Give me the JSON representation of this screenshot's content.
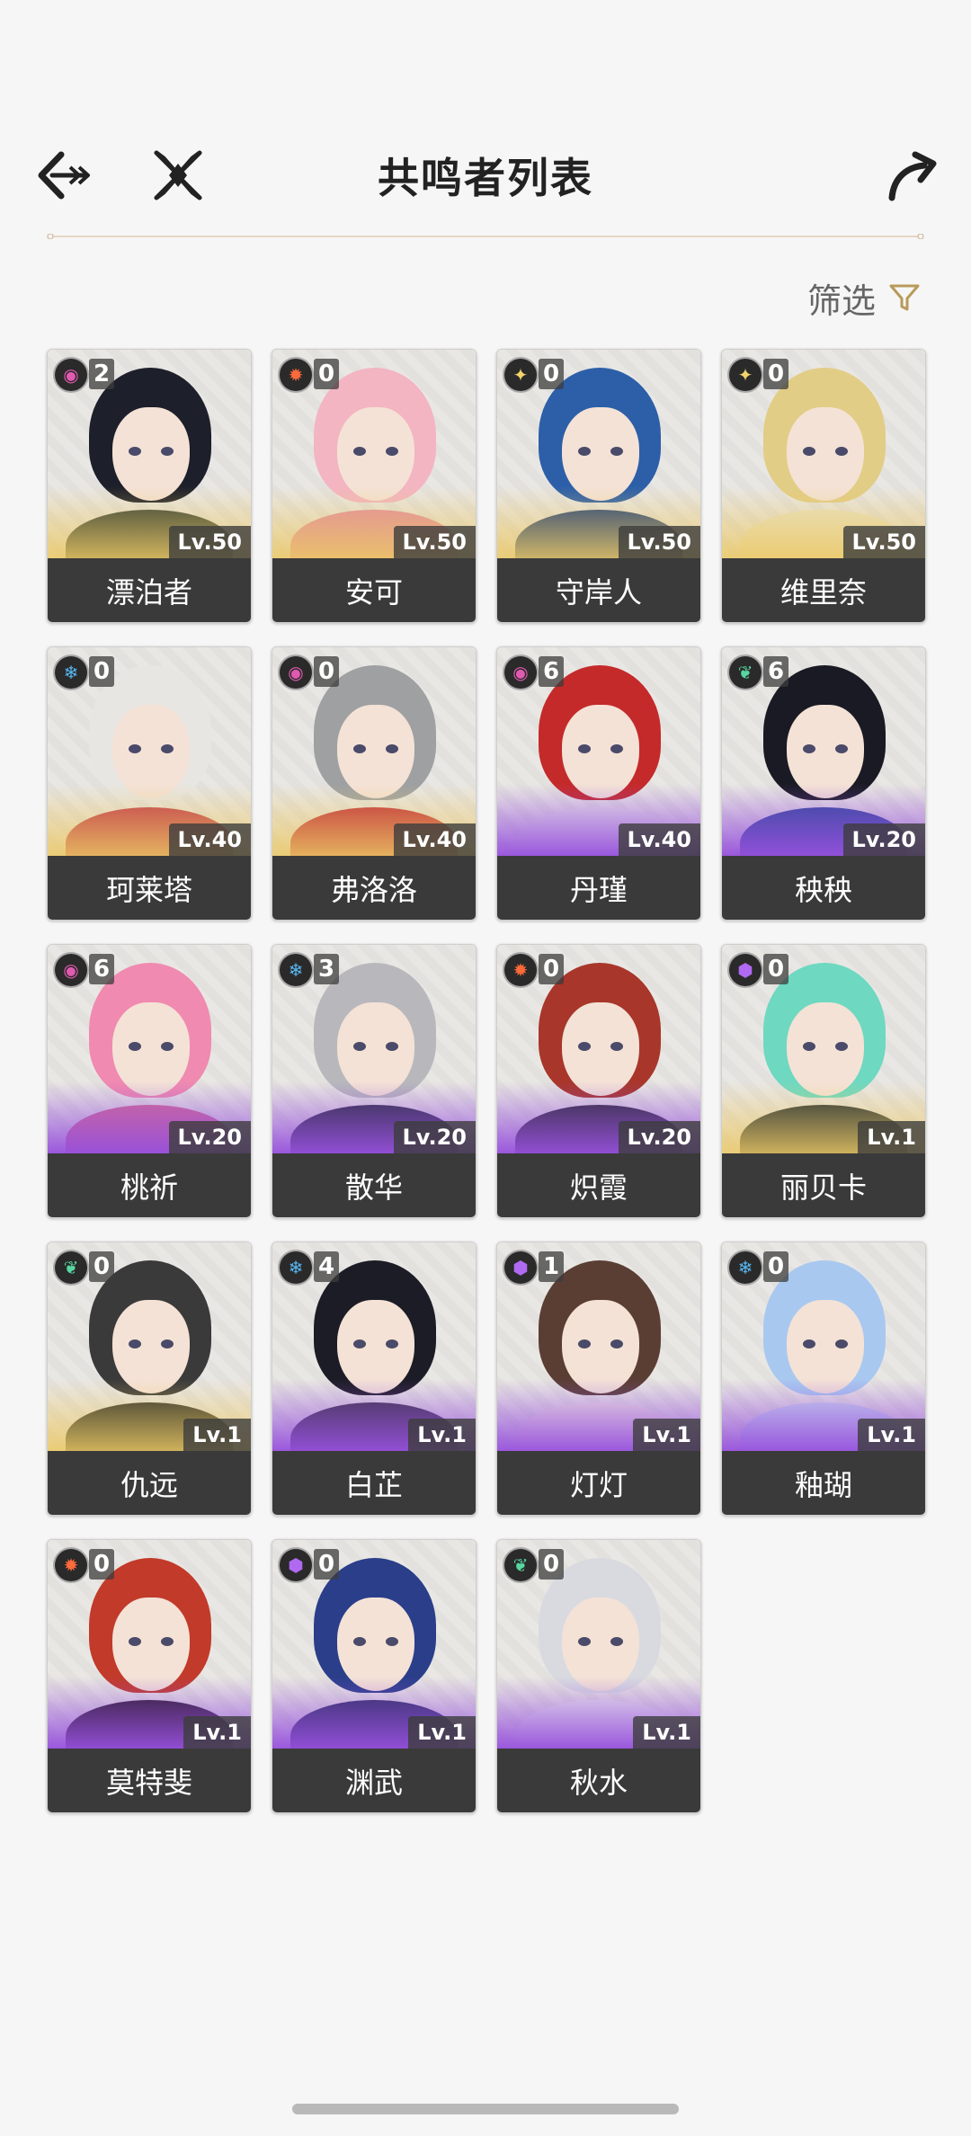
{
  "header": {
    "title": "共鸣者列表"
  },
  "filter": {
    "label": "筛选"
  },
  "accent": "#b89a5a",
  "characters": [
    {
      "name": "漂泊者",
      "rank": "2",
      "level": "Lv.50",
      "element": "havoc",
      "elementColor": "#e05ab0",
      "icon": "◉",
      "bg": "gold",
      "hair": "#1d1f2a",
      "clothes": "#2f3b35"
    },
    {
      "name": "安可",
      "rank": "0",
      "level": "Lv.50",
      "element": "fusion",
      "elementColor": "#ff6a3a",
      "icon": "✹",
      "bg": "gold",
      "hair": "#f3b5c2",
      "clothes": "#e38aa0"
    },
    {
      "name": "守岸人",
      "rank": "0",
      "level": "Lv.50",
      "element": "spectro",
      "elementColor": "#f3d36a",
      "icon": "✦",
      "bg": "gold",
      "hair": "#2c5fa8",
      "clothes": "#1e3e7a"
    },
    {
      "name": "维里奈",
      "rank": "0",
      "level": "Lv.50",
      "element": "spectro",
      "elementColor": "#f3d36a",
      "icon": "✦",
      "bg": "gold",
      "hair": "#e2cd86",
      "clothes": "#e8e2c4"
    },
    {
      "name": "珂莱塔",
      "rank": "0",
      "level": "Lv.40",
      "element": "glacio",
      "elementColor": "#58b7f2",
      "icon": "❄",
      "bg": "gold",
      "hair": "#e8e6e2",
      "clothes": "#c0364a"
    },
    {
      "name": "弗洛洛",
      "rank": "0",
      "level": "Lv.40",
      "element": "havoc",
      "elementColor": "#e05ab0",
      "icon": "◉",
      "bg": "gold",
      "hair": "#9ea0a2",
      "clothes": "#c02a3a"
    },
    {
      "name": "丹瑾",
      "rank": "6",
      "level": "Lv.40",
      "element": "havoc",
      "elementColor": "#e05ab0",
      "icon": "◉",
      "bg": "purple",
      "hair": "#c42a2a",
      "clothes": "#e7e3e6"
    },
    {
      "name": "秧秧",
      "rank": "6",
      "level": "Lv.20",
      "element": "aero",
      "elementColor": "#57d6a0",
      "icon": "❦",
      "bg": "purple",
      "hair": "#1a1a24",
      "clothes": "#2e4a9a"
    },
    {
      "name": "桃祈",
      "rank": "6",
      "level": "Lv.20",
      "element": "havoc",
      "elementColor": "#e05ab0",
      "icon": "◉",
      "bg": "purple",
      "hair": "#f08ab0",
      "clothes": "#d46a94"
    },
    {
      "name": "散华",
      "rank": "3",
      "level": "Lv.20",
      "element": "glacio",
      "elementColor": "#58b7f2",
      "icon": "❄",
      "bg": "purple",
      "hair": "#b8b8bc",
      "clothes": "#2a2e40"
    },
    {
      "name": "炽霞",
      "rank": "0",
      "level": "Lv.20",
      "element": "fusion",
      "elementColor": "#ff6a3a",
      "icon": "✹",
      "bg": "purple",
      "hair": "#a8362a",
      "clothes": "#2c2c34"
    },
    {
      "name": "丽贝卡",
      "rank": "0",
      "level": "Lv.1",
      "element": "electro",
      "elementColor": "#b06af2",
      "icon": "⬢",
      "bg": "gold",
      "hair": "#6ed8c0",
      "clothes": "#1e2a34"
    },
    {
      "name": "仇远",
      "rank": "0",
      "level": "Lv.1",
      "element": "aero",
      "elementColor": "#57d6a0",
      "icon": "❦",
      "bg": "gold",
      "hair": "#3a3a3a",
      "clothes": "#2a2e2a"
    },
    {
      "name": "白芷",
      "rank": "4",
      "level": "Lv.1",
      "element": "glacio",
      "elementColor": "#58b7f2",
      "icon": "❄",
      "bg": "purple",
      "hair": "#1c1c26",
      "clothes": "#3a3446"
    },
    {
      "name": "灯灯",
      "rank": "1",
      "level": "Lv.1",
      "element": "electro",
      "elementColor": "#b06af2",
      "icon": "⬢",
      "bg": "purple",
      "hair": "#5a3e34",
      "clothes": "#efe3e0"
    },
    {
      "name": "釉瑚",
      "rank": "0",
      "level": "Lv.1",
      "element": "glacio",
      "elementColor": "#58b7f2",
      "icon": "❄",
      "bg": "purple",
      "hair": "#a8c8f0",
      "clothes": "#c8d8f0"
    },
    {
      "name": "莫特斐",
      "rank": "0",
      "level": "Lv.1",
      "element": "fusion",
      "elementColor": "#ff6a3a",
      "icon": "✹",
      "bg": "purple",
      "hair": "#c23a2a",
      "clothes": "#2a1a2a"
    },
    {
      "name": "渊武",
      "rank": "0",
      "level": "Lv.1",
      "element": "electro",
      "elementColor": "#b06af2",
      "icon": "⬢",
      "bg": "purple",
      "hair": "#2a3e8a",
      "clothes": "#2a2e60"
    },
    {
      "name": "秋水",
      "rank": "0",
      "level": "Lv.1",
      "element": "aero",
      "elementColor": "#57d6a0",
      "icon": "❦",
      "bg": "purple",
      "hair": "#d8dae0",
      "clothes": "#eaeaec"
    }
  ]
}
